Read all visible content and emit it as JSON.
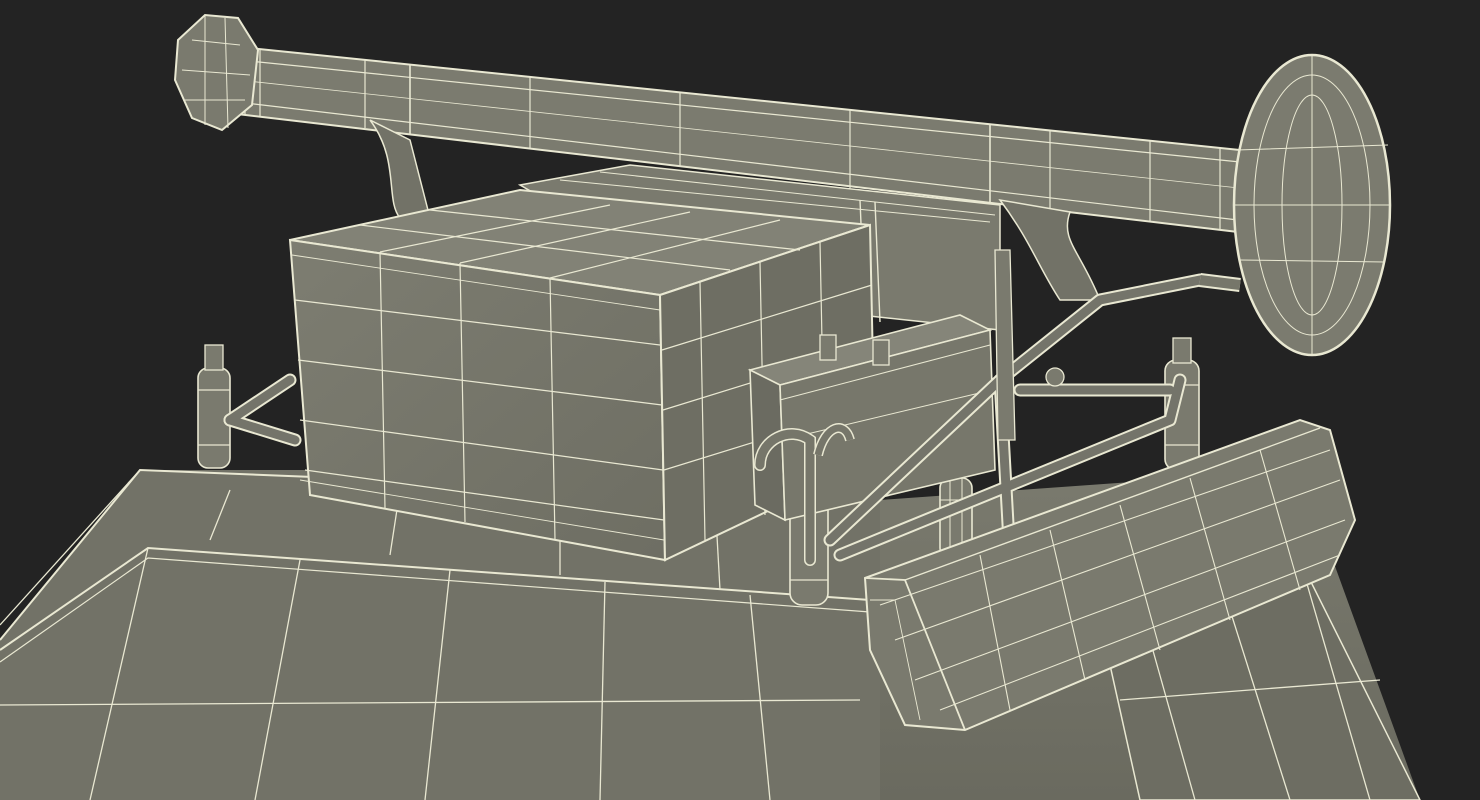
{
  "colors": {
    "background": "#232323",
    "surface": "#76766a",
    "surface_light": "#85857a",
    "surface_dark": "#5f5f55",
    "wire": "#e9e8d2",
    "edge_shadow": "#3a3a34"
  },
  "scene": {
    "subject": "wireframe-3d-model",
    "objects": [
      {
        "name": "light-bar"
      },
      {
        "name": "left-mirror"
      },
      {
        "name": "right-mirror"
      },
      {
        "name": "storage-box"
      },
      {
        "name": "battery"
      },
      {
        "name": "front-light-housing"
      },
      {
        "name": "vehicle-body"
      },
      {
        "name": "shock-absorbers"
      },
      {
        "name": "tube-frame"
      }
    ]
  }
}
